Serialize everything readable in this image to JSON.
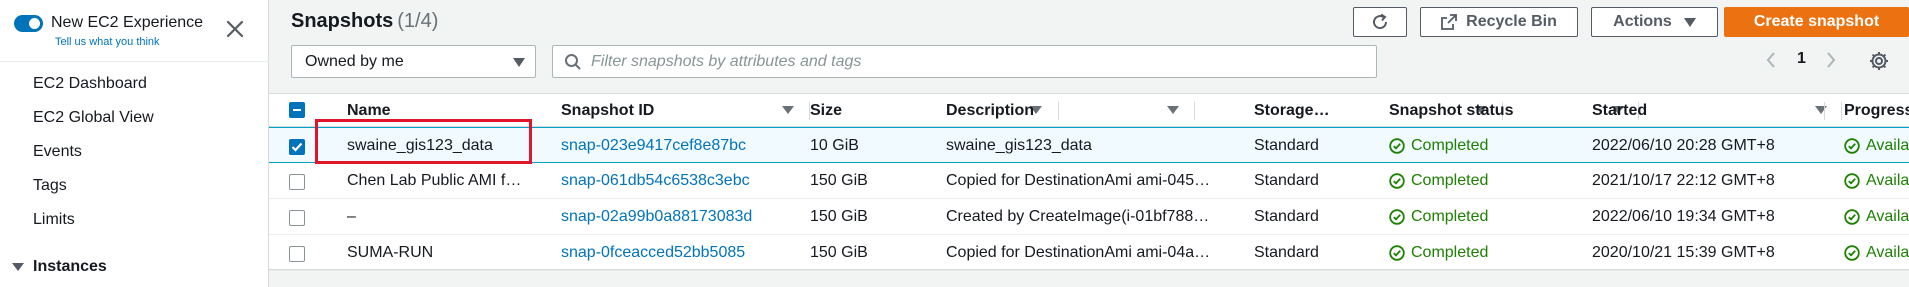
{
  "sidebar": {
    "toggle_label": "New EC2 Experience",
    "tell_us": "Tell us what you think",
    "items": [
      {
        "label": "EC2 Dashboard"
      },
      {
        "label": "EC2 Global View"
      },
      {
        "label": "Events"
      },
      {
        "label": "Tags"
      },
      {
        "label": "Limits"
      }
    ],
    "section": "Instances"
  },
  "header": {
    "title": "Snapshots",
    "count": "(1/4)",
    "recycle_bin": "Recycle Bin",
    "actions": "Actions",
    "create": "Create snapshot"
  },
  "filters": {
    "owner_selected": "Owned by me",
    "search_placeholder": "Filter snapshots by attributes and tags",
    "page": "1"
  },
  "table": {
    "columns": [
      "Name",
      "Snapshot ID",
      "Size",
      "Description",
      "Storage…",
      "Snapshot status",
      "Started",
      "Progress"
    ],
    "rows": [
      {
        "name": "swaine_gis123_data",
        "id": "snap-023e9417cef8e87bc",
        "size": "10 GiB",
        "description": "swaine_gis123_data",
        "storage": "Standard",
        "status": "Completed",
        "started": "2022/06/10 20:28 GMT+8",
        "progress": "Available",
        "selected": true
      },
      {
        "name": "Chen Lab Public AMI f…",
        "id": "snap-061db54c6538c3ebc",
        "size": "150 GiB",
        "description": "Copied for DestinationAmi ami-045…",
        "storage": "Standard",
        "status": "Completed",
        "started": "2021/10/17 22:12 GMT+8",
        "progress": "Available",
        "selected": false
      },
      {
        "name": "–",
        "id": "snap-02a99b0a88173083d",
        "size": "150 GiB",
        "description": "Created by CreateImage(i-01bf788…",
        "storage": "Standard",
        "status": "Completed",
        "started": "2022/06/10 19:34 GMT+8",
        "progress": "Available",
        "selected": false
      },
      {
        "name": "SUMA-RUN",
        "id": "snap-0fceacced52bb5085",
        "size": "150 GiB",
        "description": "Copied for DestinationAmi ami-04a…",
        "storage": "Standard",
        "status": "Completed",
        "started": "2020/10/21 15:39 GMT+8",
        "progress": "Available",
        "selected": false
      }
    ]
  },
  "colors": {
    "primary": "#ec7211",
    "link": "#0073bb",
    "success": "#1d8102",
    "highlight": "#e0152b"
  }
}
